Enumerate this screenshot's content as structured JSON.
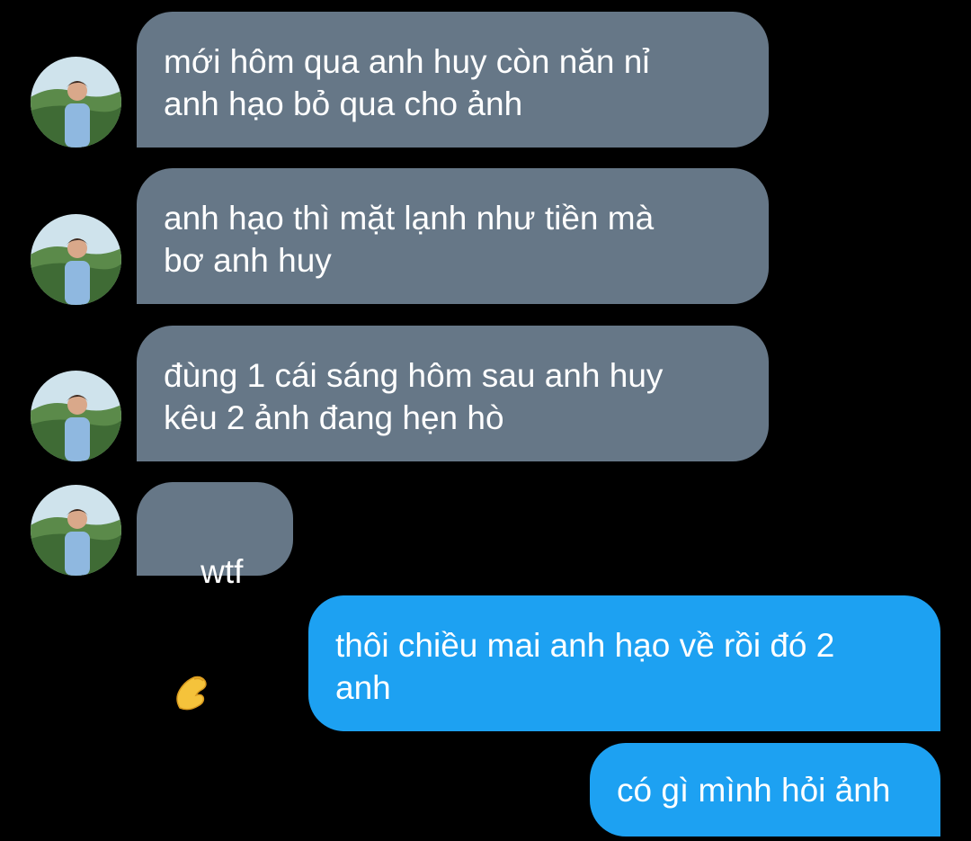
{
  "thread": {
    "incoming": [
      {
        "text": "mới hôm qua anh huy còn năn nỉ\nanh hạo bỏ qua cho ảnh"
      },
      {
        "text": "anh hạo thì mặt lạnh như tiền mà\nbơ anh huy"
      },
      {
        "text": "đùng 1 cái sáng hôm sau anh huy\nkêu 2 ảnh đang hẹn hò"
      },
      {
        "text": "wtf",
        "emoji": "pinching-hand-emoji"
      }
    ],
    "outgoing": [
      {
        "text": "thôi chiều mai anh hạo về rồi đó 2\nanh"
      },
      {
        "text": "có gì mình hỏi ảnh"
      }
    ]
  },
  "colors": {
    "background": "#000000",
    "incoming_bubble": "#667787",
    "outgoing_bubble": "#1da1f2",
    "text": "#ffffff"
  }
}
